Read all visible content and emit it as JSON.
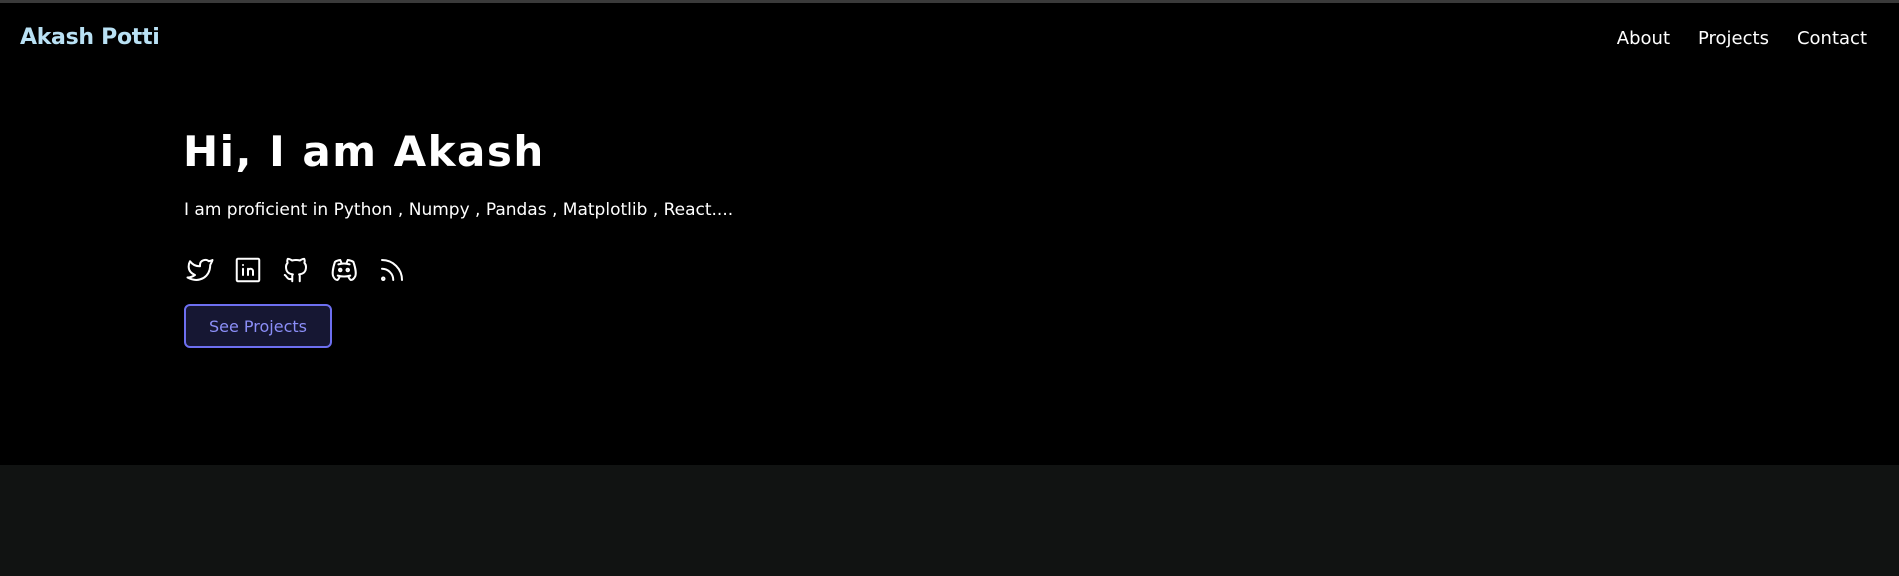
{
  "header": {
    "brand": "Akash Potti",
    "nav": [
      {
        "label": "About"
      },
      {
        "label": "Projects"
      },
      {
        "label": "Contact"
      }
    ]
  },
  "hero": {
    "heading": "Hi, I am Akash",
    "tagline": "I am proficient in Python , Numpy , Pandas , Matplotlib , React....",
    "socials": [
      {
        "icon": "twitter-icon"
      },
      {
        "icon": "linkedin-icon"
      },
      {
        "icon": "github-icon"
      },
      {
        "icon": "discord-icon"
      },
      {
        "icon": "rss-icon"
      }
    ],
    "cta_label": "See Projects"
  },
  "colors": {
    "background": "#000000",
    "lower_section": "#111312",
    "brand": "#b9e1f4",
    "accent": "#6d6ff0",
    "text": "#ffffff"
  }
}
